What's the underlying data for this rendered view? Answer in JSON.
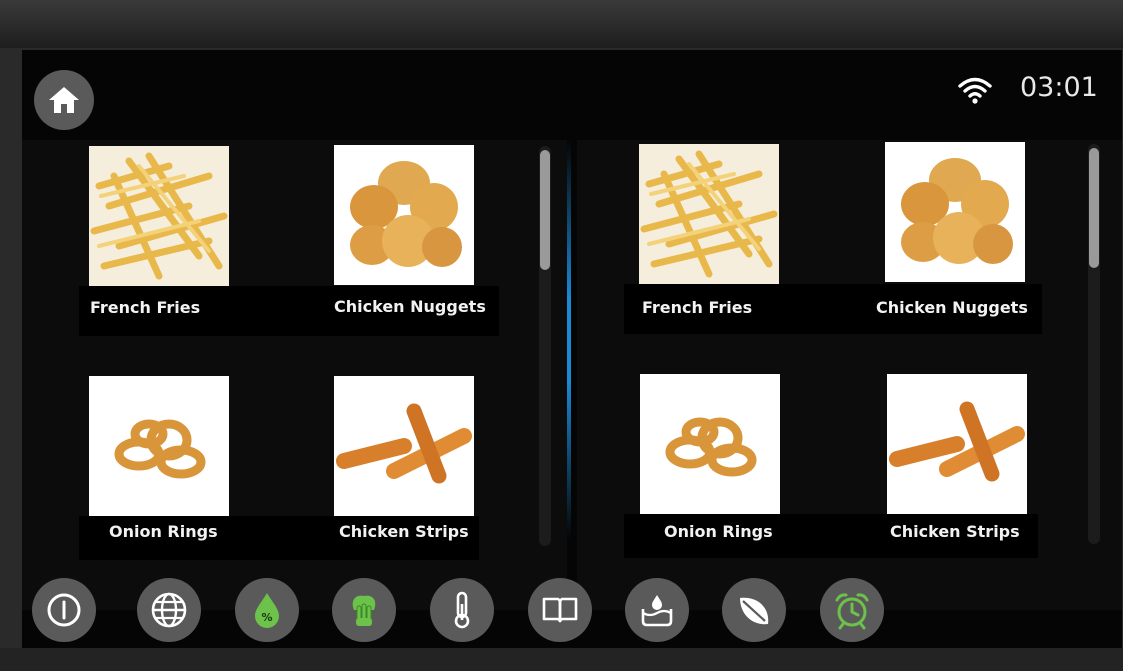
{
  "status_bar": {
    "home_icon": "home-icon",
    "wifi_icon": "wifi-icon",
    "time": "03:01"
  },
  "left_panel": {
    "items": [
      {
        "label": "French Fries",
        "image": "french-fries-image"
      },
      {
        "label": "Chicken Nuggets",
        "image": "chicken-nuggets-image"
      },
      {
        "label": "Onion Rings",
        "image": "onion-rings-image"
      },
      {
        "label": "Chicken Strips",
        "image": "chicken-strips-image"
      }
    ]
  },
  "right_panel": {
    "items": [
      {
        "label": "French Fries",
        "image": "french-fries-image"
      },
      {
        "label": "Chicken Nuggets",
        "image": "chicken-nuggets-image"
      },
      {
        "label": "Onion Rings",
        "image": "onion-rings-image"
      },
      {
        "label": "Chicken Strips",
        "image": "chicken-strips-image"
      }
    ]
  },
  "toolbar": {
    "buttons": [
      {
        "icon": "power-icon",
        "color": "#5a5a5a"
      },
      {
        "icon": "globe-icon",
        "color": "#5a5a5a"
      },
      {
        "icon": "oil-quality-icon",
        "color": "#5a5a5a"
      },
      {
        "icon": "hand-wash-icon",
        "color": "#5a5a5a"
      },
      {
        "icon": "thermometer-icon",
        "color": "#5a5a5a"
      },
      {
        "icon": "book-icon",
        "color": "#5a5a5a"
      },
      {
        "icon": "water-basin-icon",
        "color": "#5a5a5a"
      },
      {
        "icon": "leaf-icon",
        "color": "#5a5a5a"
      },
      {
        "icon": "alarm-clock-icon",
        "color": "#5a5a5a"
      }
    ]
  },
  "colors": {
    "accent_green": "#6cc24a",
    "divider_blue": "#1a8ad8",
    "button_gray": "#5a5a5a"
  }
}
